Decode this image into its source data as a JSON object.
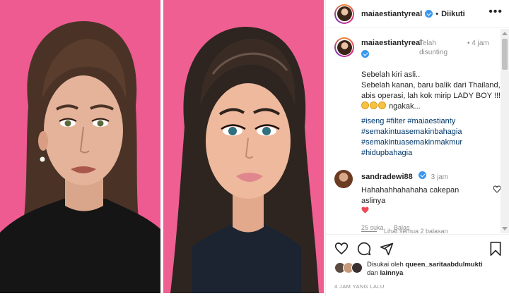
{
  "header": {
    "username": "maiaestiantyreal",
    "separator": "•",
    "follow_state": "Diikuti",
    "more_icon": "more-horizontal-icon"
  },
  "caption": {
    "username": "maiaestiantyreal",
    "edited_label": "Telah disunting",
    "time_sep": "•",
    "time": "4 jam",
    "lines": [
      "Sebelah kiri asli..",
      "Sebelah kanan, baru balik dari Thailand,",
      "abis operasi, lah kok mirip LADY BOY !!!",
      "ngakak..."
    ],
    "hashtags": [
      "#iseng #filter #maiaestianty",
      "#semakintuasemakinbahagia",
      "#semakintuasemakinmakmur",
      "#hidupbahagia"
    ]
  },
  "comment": {
    "username": "sandradewi88",
    "time": "3 jam",
    "text": "Hahahahhahahaha cakepan aslinya",
    "likes": "25 suka",
    "reply": "Balas",
    "view_replies": "Lihat semua 2 balasan"
  },
  "actions": {
    "icons": [
      "heart-icon",
      "comment-icon",
      "share-icon",
      "bookmark-icon"
    ]
  },
  "likes": {
    "prefix": "Disukai oleh",
    "user": "queen_saritaabdulmukti",
    "and": "dan",
    "others": "lainnya"
  },
  "timestamp": "4 JAM YANG LALU",
  "colors": {
    "background_pink": "#ee5b91",
    "verified_blue": "#3897f0",
    "hashtag_blue": "#00376b",
    "heart_red": "#ed4956"
  }
}
